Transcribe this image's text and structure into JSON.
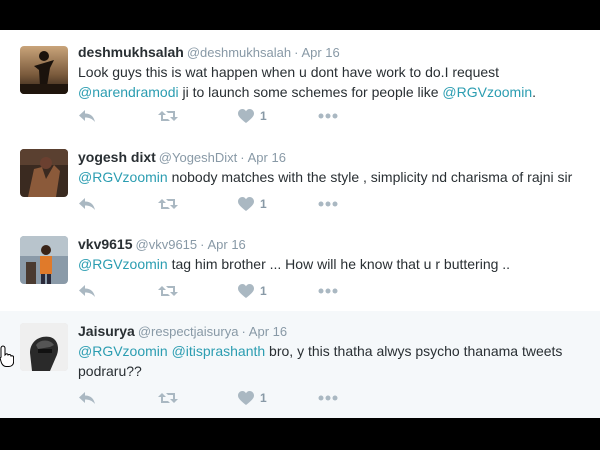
{
  "tweets": [
    {
      "name": "deshmukhsalah",
      "handle": "@deshmukhsalah",
      "date": "Apr 16",
      "text_parts": [
        {
          "t": "Look guys this is wat happen when u dont have work to do.I request ",
          "m": false
        },
        {
          "t": "@narendramodi",
          "m": true
        },
        {
          "t": " ji to launch some schemes for people like ",
          "m": false
        },
        {
          "t": "@RGVzoomin",
          "m": true
        },
        {
          "t": ".",
          "m": false
        }
      ],
      "likes": "1"
    },
    {
      "name": "yogesh dixt",
      "handle": "@YogeshDixt",
      "date": "Apr 16",
      "text_parts": [
        {
          "t": "@RGVzoomin",
          "m": true
        },
        {
          "t": " nobody matches with the style , simplicity nd charisma of rajni sir",
          "m": false
        }
      ],
      "likes": "1"
    },
    {
      "name": "vkv9615",
      "handle": "@vkv9615",
      "date": "Apr 16",
      "text_parts": [
        {
          "t": "@RGVzoomin",
          "m": true
        },
        {
          "t": " tag him brother ... How will he know that u r buttering  ..",
          "m": false
        }
      ],
      "likes": "1"
    },
    {
      "name": "Jaisurya",
      "handle": "@respectjaisurya",
      "date": "Apr 16",
      "text_parts": [
        {
          "t": "@RGVzoomin",
          "m": true
        },
        {
          "t": " ",
          "m": false
        },
        {
          "t": "@itisprashanth",
          "m": true
        },
        {
          "t": " bro, y this thatha alwys psycho thanama tweets podraru??",
          "m": false
        }
      ],
      "likes": "1"
    }
  ],
  "colors": {
    "mention": "#2b9db1",
    "name": "#292f33",
    "meta": "#8899a6",
    "icon": "#aab8c2"
  },
  "icons": [
    "reply-icon",
    "retweet-icon",
    "heart-icon",
    "more-icon",
    "pointer-cursor-icon"
  ]
}
